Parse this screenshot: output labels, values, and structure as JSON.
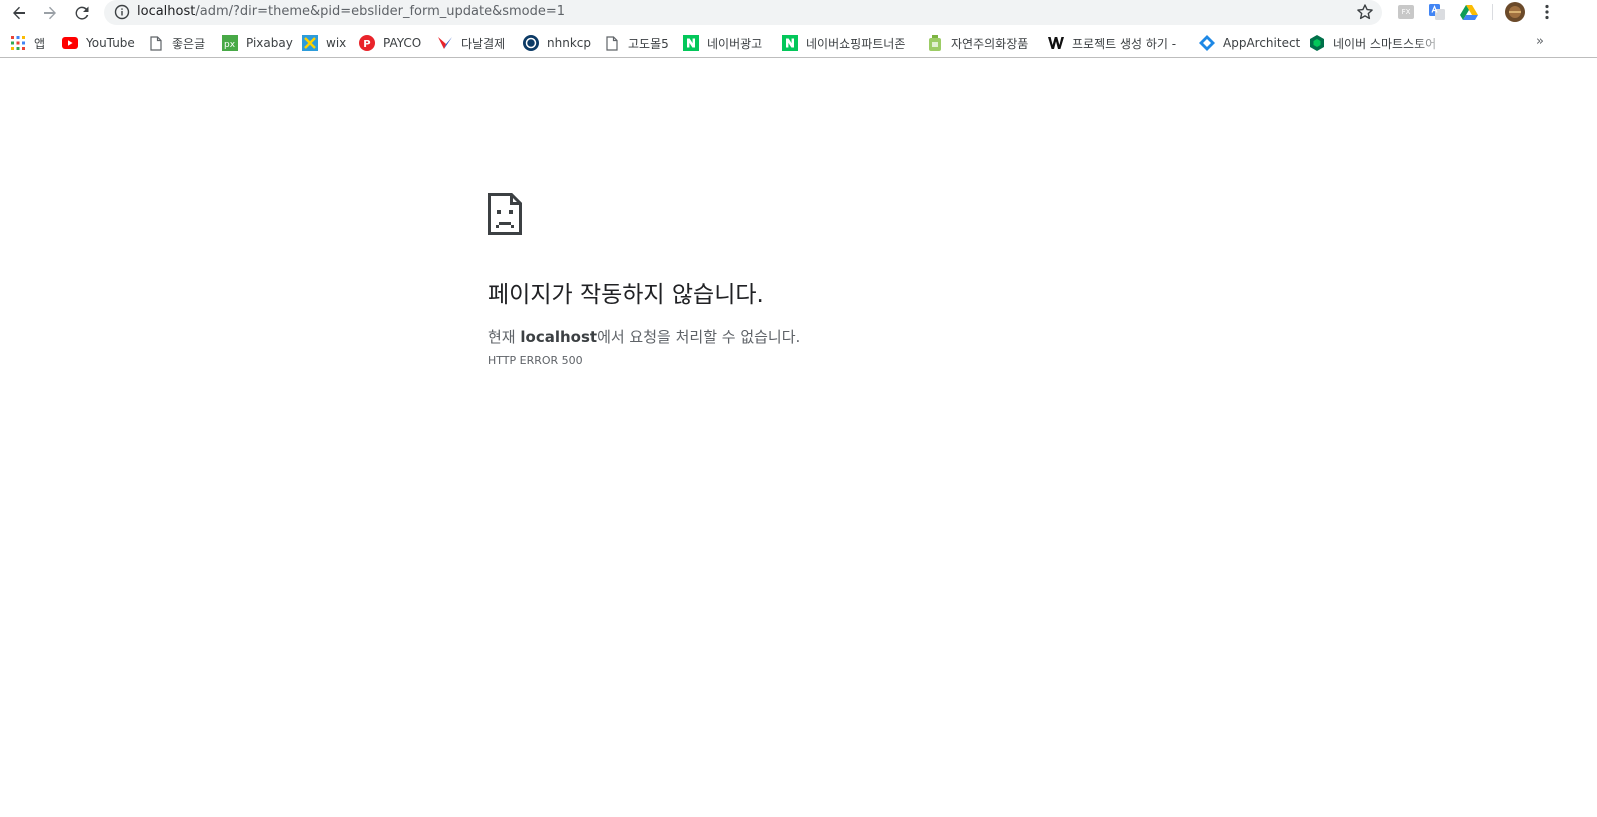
{
  "toolbar": {
    "url_host": "localhost",
    "url_path": "/adm/?dir=theme&pid=ebslider_form_update&smode=1"
  },
  "bookmarks": [
    {
      "label": "앱",
      "icon": "apps-grid-icon"
    },
    {
      "label": "YouTube",
      "icon": "youtube-icon"
    },
    {
      "label": "좋은글",
      "icon": "page-icon"
    },
    {
      "label": "Pixabay",
      "icon": "pixabay-icon"
    },
    {
      "label": "wix",
      "icon": "wix-icon"
    },
    {
      "label": "PAYCO",
      "icon": "payco-icon"
    },
    {
      "label": "다날결제",
      "icon": "danal-icon"
    },
    {
      "label": "nhnkcp",
      "icon": "nhnkcp-icon"
    },
    {
      "label": "고도몰5",
      "icon": "page-icon"
    },
    {
      "label": "네이버광고",
      "icon": "naver-icon"
    },
    {
      "label": "네이버쇼핑파트너존",
      "icon": "naver-icon"
    },
    {
      "label": "자연주의화장품",
      "icon": "bottle-icon"
    },
    {
      "label": "프로젝트 생성 하기 -",
      "icon": "w-icon"
    },
    {
      "label": "AppArchitect",
      "icon": "apparchitect-icon"
    },
    {
      "label": "네이버 스마트스토어",
      "icon": "smartstore-icon"
    }
  ],
  "overflow_label": "»",
  "extensions": {
    "ext1_label": "FX"
  },
  "error": {
    "title": "페이지가 작동하지 않습니다.",
    "message_prefix": "현재 ",
    "message_host": "localhost",
    "message_suffix": "에서 요청을 처리할 수 없습니다.",
    "code": "HTTP ERROR 500"
  },
  "colors": {
    "youtube": "#ff0000",
    "naver": "#03c75a",
    "payco": "#e9242b",
    "pixabay": "#48a947",
    "wix": "#2d9cdb",
    "text": "#202124",
    "muted": "#5f6368"
  }
}
